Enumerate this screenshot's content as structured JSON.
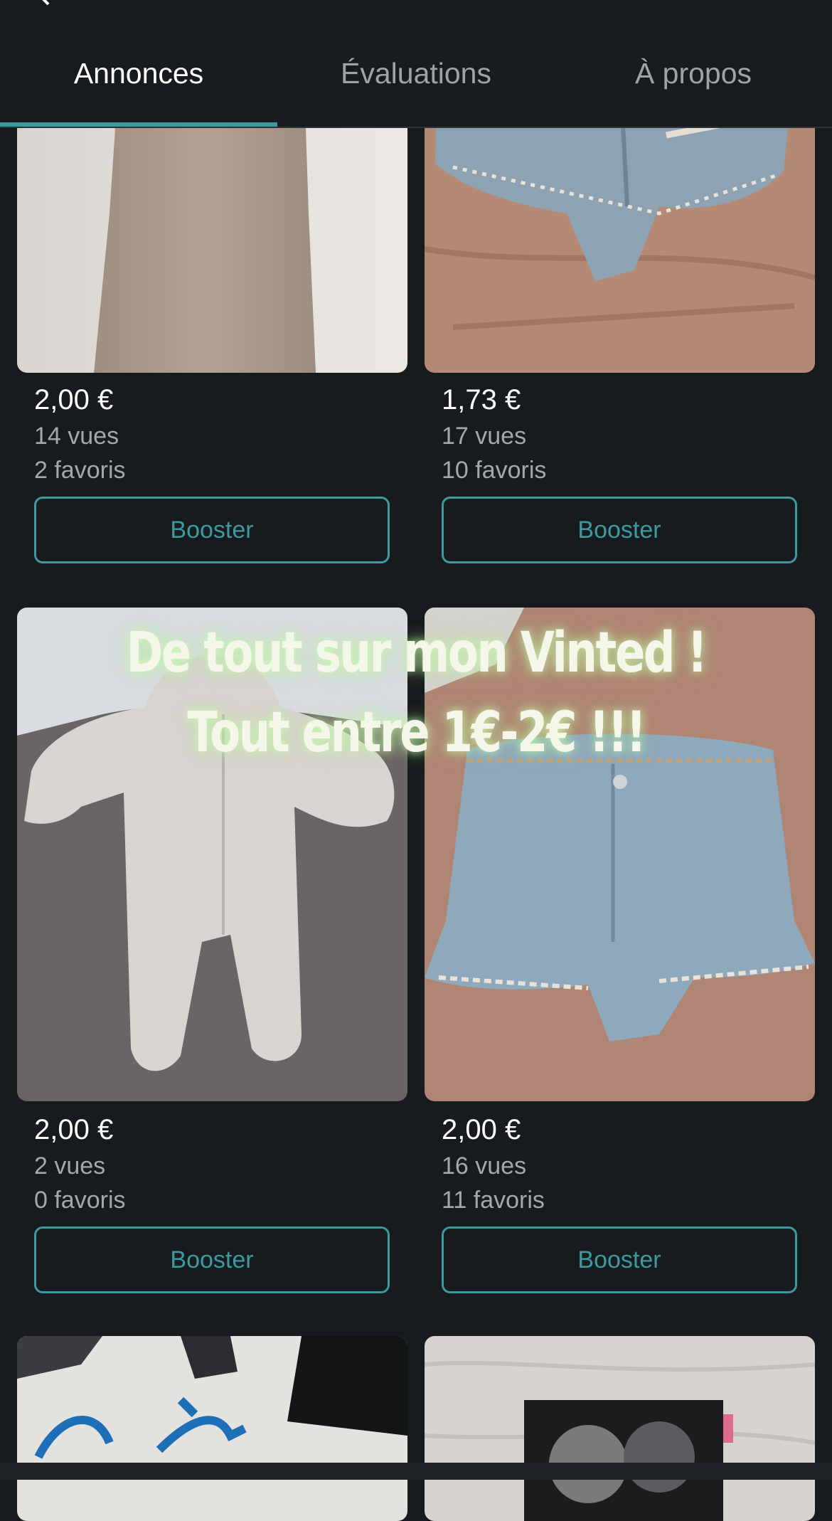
{
  "tabs": [
    {
      "label": "Annonces",
      "active": true
    },
    {
      "label": "Évaluations",
      "active": false
    },
    {
      "label": "À propos",
      "active": false
    }
  ],
  "overlay_text": "De tout sur mon Vinted ! Tout entre 1€-2€ !!!",
  "items": [
    {
      "price": "2,00 €",
      "views": "14 vues",
      "favorites": "2 favoris",
      "boost": "Booster",
      "photo": "beige-dress"
    },
    {
      "price": "1,73 €",
      "views": "17 vues",
      "favorites": "10 favoris",
      "boost": "Booster",
      "photo": "ripped-denim-shorts"
    },
    {
      "price": "2,00 €",
      "views": "2 vues",
      "favorites": "0 favoris",
      "boost": "Booster",
      "photo": "fleece-baby-onesie"
    },
    {
      "price": "2,00 €",
      "views": "16 vues",
      "favorites": "11 favoris",
      "boost": "Booster",
      "photo": "denim-shorts"
    },
    {
      "photo": "clothes-with-blue-ribbon"
    },
    {
      "photo": "printed-tshirt"
    }
  ],
  "colors": {
    "background": "#171b1d",
    "accent": "#3b9aa0",
    "muted_text": "#a4a8a9"
  }
}
